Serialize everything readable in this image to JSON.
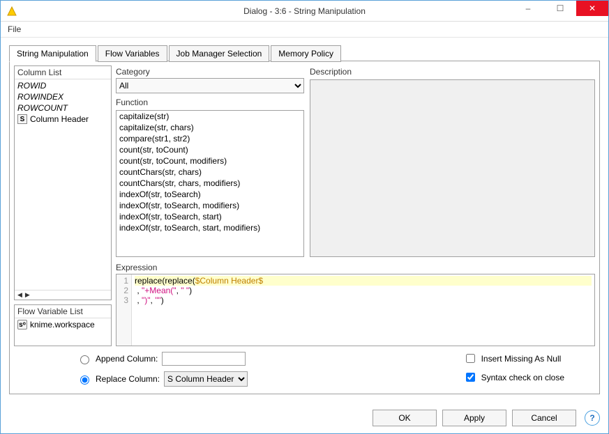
{
  "window": {
    "title": "Dialog - 3:6 - String Manipulation",
    "minimize_icon": "–",
    "maximize_icon": "☐",
    "close_icon": "✕"
  },
  "menu": {
    "file": "File"
  },
  "tabs": [
    {
      "label": "String Manipulation",
      "active": true
    },
    {
      "label": "Flow Variables",
      "active": false
    },
    {
      "label": "Job Manager Selection",
      "active": false
    },
    {
      "label": "Memory Policy",
      "active": false
    }
  ],
  "column_list": {
    "title": "Column List",
    "items_italic": [
      "ROWID",
      "ROWINDEX",
      "ROWCOUNT"
    ],
    "item_column": "Column Header"
  },
  "flow_var_list": {
    "title": "Flow Variable List",
    "item": "knime.workspace",
    "icon_letter": "sᵒ"
  },
  "category": {
    "label": "Category",
    "value": "All"
  },
  "function_section": {
    "label": "Function",
    "items": [
      "capitalize(str)",
      "capitalize(str, chars)",
      "compare(str1, str2)",
      "count(str, toCount)",
      "count(str, toCount, modifiers)",
      "countChars(str, chars)",
      "countChars(str, chars, modifiers)",
      "indexOf(str, toSearch)",
      "indexOf(str, toSearch, modifiers)",
      "indexOf(str, toSearch, start)",
      "indexOf(str, toSearch, start, modifiers)"
    ]
  },
  "description": {
    "label": "Description"
  },
  "expression": {
    "label": "Expression",
    "lines": [
      {
        "n": "1",
        "hl": true,
        "parts": [
          {
            "t": "replace",
            "c": "fn"
          },
          {
            "t": "(",
            "c": ""
          },
          {
            "t": "replace",
            "c": "fn"
          },
          {
            "t": "(",
            "c": ""
          },
          {
            "t": "$Column Header$",
            "c": "var"
          }
        ]
      },
      {
        "n": "2",
        "hl": false,
        "parts": [
          {
            "t": " , ",
            "c": ""
          },
          {
            "t": "\"+Mean(\"",
            "c": "str"
          },
          {
            "t": ", ",
            "c": ""
          },
          {
            "t": "\" \"",
            "c": "str"
          },
          {
            "t": ")",
            "c": ""
          }
        ]
      },
      {
        "n": "3",
        "hl": false,
        "parts": [
          {
            "t": " , ",
            "c": ""
          },
          {
            "t": "\")\"",
            "c": "str"
          },
          {
            "t": ", ",
            "c": ""
          },
          {
            "t": "\"\"",
            "c": "str"
          },
          {
            "t": ")",
            "c": ""
          }
        ]
      }
    ]
  },
  "options": {
    "append": "Append Column:",
    "replace": "Replace Column:",
    "replace_value": "Column Header",
    "insert_null": "Insert Missing As Null",
    "syntax_check": "Syntax check on close",
    "radio_selected": "replace",
    "syntax_checked": true,
    "null_checked": false
  },
  "buttons": {
    "ok": "OK",
    "apply": "Apply",
    "cancel": "Cancel",
    "help": "?"
  }
}
